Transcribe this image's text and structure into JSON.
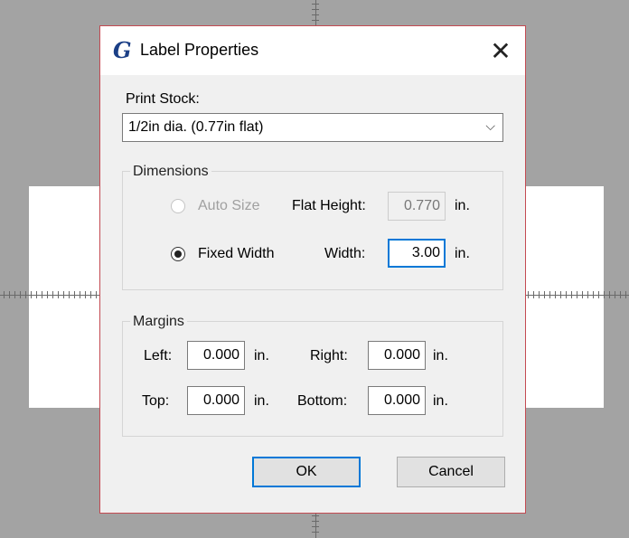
{
  "dialog": {
    "title": "Label Properties",
    "app_icon": "G",
    "close_glyph": "✕"
  },
  "print_stock": {
    "label": "Print Stock:",
    "value": "1/2in dia. (0.77in flat)",
    "arrow": "⌵"
  },
  "dimensions": {
    "caption": "Dimensions",
    "auto_size_label": "Auto Size",
    "flat_height_label": "Flat Height:",
    "flat_height_value": "0.770",
    "fixed_width_label": "Fixed Width",
    "width_label": "Width:",
    "width_value": "3.00",
    "unit": "in."
  },
  "margins": {
    "caption": "Margins",
    "left_label": "Left:",
    "left_value": "0.000",
    "right_label": "Right:",
    "right_value": "0.000",
    "top_label": "Top:",
    "top_value": "0.000",
    "bottom_label": "Bottom:",
    "bottom_value": "0.000",
    "unit": "in."
  },
  "buttons": {
    "ok": "OK",
    "cancel": "Cancel"
  }
}
